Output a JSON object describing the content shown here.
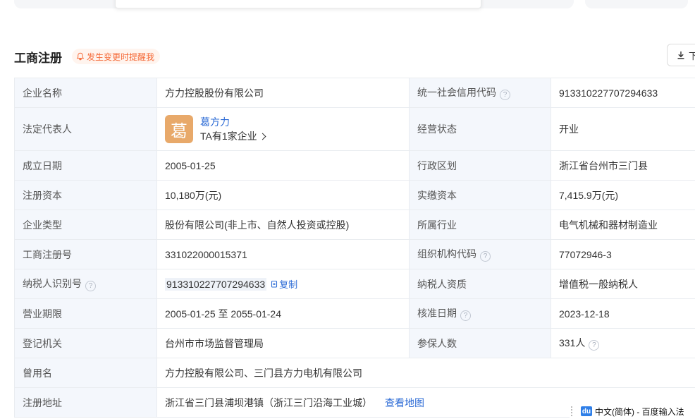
{
  "header": {
    "title": "工商注册",
    "remind_label": "发生变更时提醒我",
    "download_label": "下"
  },
  "rep": {
    "avatar_char": "葛",
    "name": "葛方力",
    "sub": "TA有1家企业"
  },
  "rows": {
    "company_name": {
      "label": "企业名称",
      "value": "方力控股股份有限公司"
    },
    "credit_code": {
      "label": "统一社会信用代码",
      "value": "913310227707294633"
    },
    "legal_rep": {
      "label": "法定代表人"
    },
    "status": {
      "label": "经营状态",
      "value": "开业"
    },
    "founded": {
      "label": "成立日期",
      "value": "2005-01-25"
    },
    "region": {
      "label": "行政区划",
      "value": "浙江省台州市三门县"
    },
    "reg_capital": {
      "label": "注册资本",
      "value": "10,180万(元)"
    },
    "paid_capital": {
      "label": "实缴资本",
      "value": "7,415.9万(元)"
    },
    "company_type": {
      "label": "企业类型",
      "value": "股份有限公司(非上市、自然人投资或控股)"
    },
    "industry": {
      "label": "所属行业",
      "value": "电气机械和器材制造业"
    },
    "reg_no": {
      "label": "工商注册号",
      "value": "331022000015371"
    },
    "org_code": {
      "label": "组织机构代码",
      "value": "77072946-3"
    },
    "taxpayer_id": {
      "label": "纳税人识别号",
      "value": "913310227707294633",
      "copy_label": "复制"
    },
    "taxpayer_qual": {
      "label": "纳税人资质",
      "value": "增值税一般纳税人"
    },
    "term": {
      "label": "营业期限",
      "value": "2005-01-25 至 2055-01-24"
    },
    "approval_date": {
      "label": "核准日期",
      "value": "2023-12-18"
    },
    "authority": {
      "label": "登记机关",
      "value": "台州市市场监督管理局"
    },
    "insured": {
      "label": "参保人数",
      "value": "331人"
    },
    "former_name": {
      "label": "曾用名",
      "value": "方力控股有限公司、三门县方力电机有限公司"
    },
    "address": {
      "label": "注册地址",
      "value": "浙江省三门县浦坝港镇（浙江三门沿海工业城）",
      "map_label": "查看地图"
    }
  },
  "ime": {
    "logo": "du",
    "text": "中文(简体) - 百度输入法"
  },
  "colors": {
    "link": "#2e6cd6",
    "remind": "#f56b3a",
    "label_bg": "#f4f7fc",
    "avatar": "#e8a96a"
  }
}
